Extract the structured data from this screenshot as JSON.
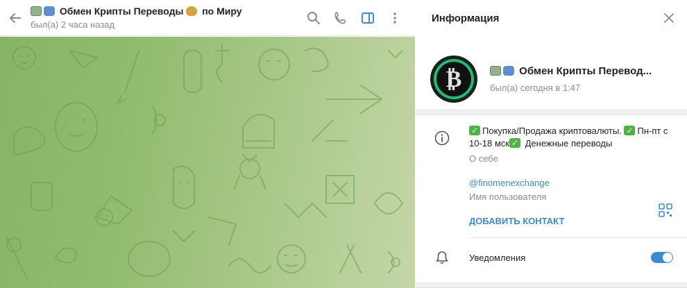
{
  "chat": {
    "title_prefix_emojis": [
      "money-icon",
      "cycle-arrows-icon"
    ],
    "title_part1": "Обмен Крипты Переводы",
    "title_part2": "по Миру",
    "status": "был(а) 2 часа назад"
  },
  "info": {
    "header_title": "Информация",
    "profile_name": "Обмен Крипты Перевод...",
    "profile_status": "был(а) сегодня в 1:47",
    "about_part1": "Покупка/Продажа криптовалюты.",
    "about_part2": "Пн-пт с 10-18 мск",
    "about_part3": "Денежные переводы",
    "about_label": "О себе",
    "username": "@finomenexchange",
    "username_label": "Имя пользователя",
    "add_contact": "ДОБАВИТЬ КОНТАКТ",
    "notifications_label": "Уведомления",
    "notifications_on": true
  },
  "colors": {
    "accent": "#3a8bd6",
    "chat_bg_start": "#86b465",
    "chat_bg_end": "#c5d6a7",
    "check_green": "#4bb543"
  }
}
